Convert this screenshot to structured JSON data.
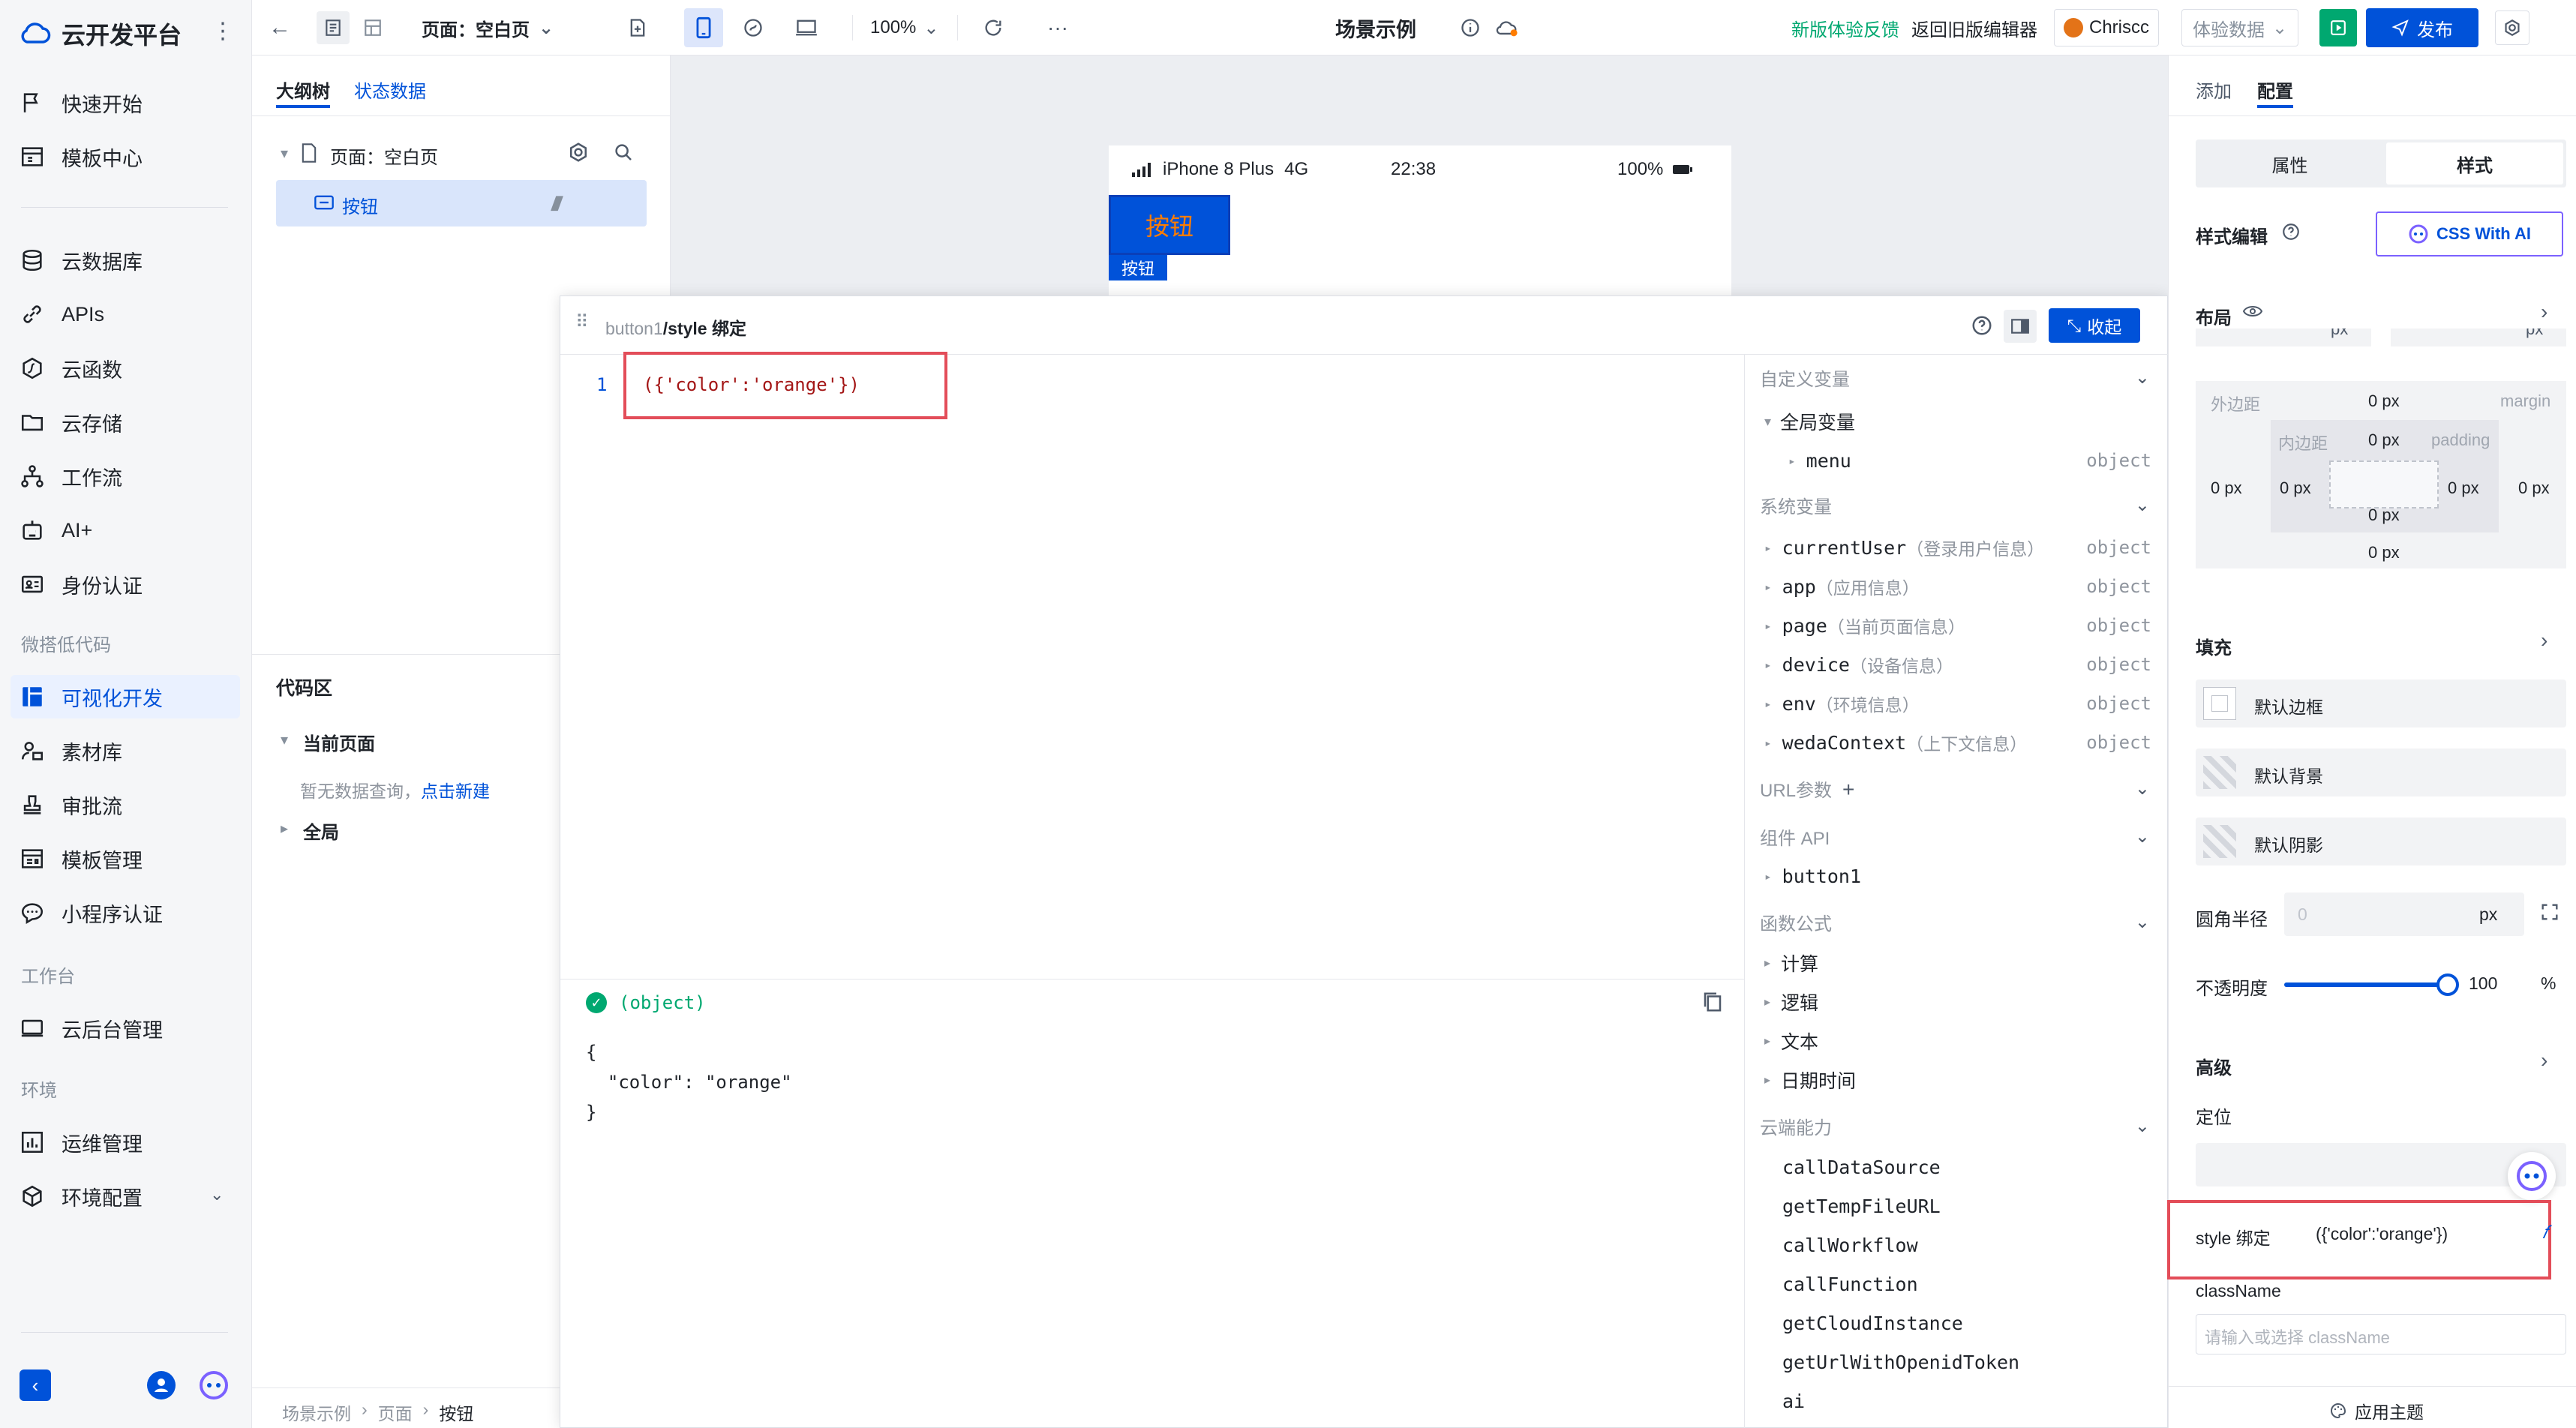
{
  "brand": {
    "name": "云开发平台"
  },
  "sidebar": {
    "items": [
      {
        "label": "快速开始"
      },
      {
        "label": "模板中心"
      },
      {
        "label": "云数据库"
      },
      {
        "label": "APIs"
      },
      {
        "label": "云函数"
      },
      {
        "label": "云存储"
      },
      {
        "label": "工作流"
      },
      {
        "label": "AI+"
      },
      {
        "label": "身份认证"
      }
    ],
    "group_lowcode": "微搭低代码",
    "lowcode_items": [
      {
        "label": "可视化开发"
      },
      {
        "label": "素材库"
      },
      {
        "label": "审批流"
      },
      {
        "label": "模板管理"
      },
      {
        "label": "小程序认证"
      }
    ],
    "group_workbench": "工作台",
    "workbench_items": [
      {
        "label": "云后台管理"
      }
    ],
    "group_env": "环境",
    "env_items": [
      {
        "label": "运维管理"
      },
      {
        "label": "环境配置"
      }
    ]
  },
  "topbar": {
    "page_select": "页面：空白页",
    "zoom": "100%",
    "title": "场景示例",
    "feedback": "新版体验反馈",
    "back_old": "返回旧版编辑器",
    "user": "Chriscc",
    "data_select": "体验数据",
    "publish": "发布",
    "more": "···"
  },
  "outline": {
    "tabs": [
      "大纲树",
      "状态数据"
    ],
    "page_node": "页面：空白页",
    "button_node": "按钮",
    "code_area_title": "代码区",
    "current_page": "当前页面",
    "no_query": "暂无数据查询，",
    "create_new": "点击新建",
    "global": "全局",
    "breadcrumb": [
      "场景示例",
      "页面",
      "按钮"
    ]
  },
  "canvas": {
    "device": "iPhone 8 Plus",
    "network": "4G",
    "time": "22:38",
    "battery": "100%",
    "button_label": "按钮",
    "selected_tag": "按钮"
  },
  "dialog": {
    "path_prefix": "button1",
    "path_suffix": "/style 绑定",
    "collapse": "收起",
    "line_number": "1",
    "code": "({'color':'orange'})",
    "result_type": "(object)",
    "result_lines": [
      "{",
      "  \"color\": \"orange\"",
      "}"
    ],
    "sections": {
      "custom_vars": "自定义变量",
      "global_vars": "全局变量",
      "menu": "menu",
      "system_vars": "系统变量",
      "url_params": "URL参数",
      "component_api": "组件 API",
      "button1": "button1",
      "formulas": "函数公式",
      "cloud": "云端能力"
    },
    "system_items": [
      {
        "name": "currentUser",
        "desc": "（登录用户信息）",
        "type": "object"
      },
      {
        "name": "app",
        "desc": "（应用信息）",
        "type": "object"
      },
      {
        "name": "page",
        "desc": "（当前页面信息）",
        "type": "object"
      },
      {
        "name": "device",
        "desc": "（设备信息）",
        "type": "object"
      },
      {
        "name": "env",
        "desc": "（环境信息）",
        "type": "object"
      },
      {
        "name": "wedaContext",
        "desc": "（上下文信息）",
        "type": "object"
      }
    ],
    "menu_type": "object",
    "formula_items": [
      "计算",
      "逻辑",
      "文本",
      "日期时间"
    ],
    "cloud_items": [
      "callDataSource",
      "getTempFileURL",
      "callWorkflow",
      "callFunction",
      "getCloudInstance",
      "getUrlWithOpenidToken",
      "ai"
    ]
  },
  "right": {
    "tabs": [
      "添加",
      "配置"
    ],
    "seg": [
      "属性",
      "样式"
    ],
    "style_edit": "样式编辑",
    "css_ai": "CSS With AI",
    "layout": "布局",
    "px": "px",
    "margin_label": "外边距",
    "margin_word": "margin",
    "padding_label": "内边距",
    "padding_word": "padding",
    "zero_px": "0 px",
    "fill": "填充",
    "border_default": "默认边框",
    "bg_default": "默认背景",
    "shadow_default": "默认阴影",
    "radius": "圆角半径",
    "radius_placeholder": "0",
    "opacity": "不透明度",
    "opacity_value": "100",
    "opacity_pct": 100,
    "percent": "%",
    "advanced": "高级",
    "position": "定位",
    "style_bind": "style 绑定",
    "style_bind_value": "({'color':'orange'})",
    "classname": "className",
    "classname_placeholder": "请输入或选择 className",
    "apply_theme": "应用主题"
  },
  "colors": {
    "accent": "#0052d9",
    "highlight": "#e34d59",
    "green": "#00a870",
    "orange": "#ff7d00"
  }
}
